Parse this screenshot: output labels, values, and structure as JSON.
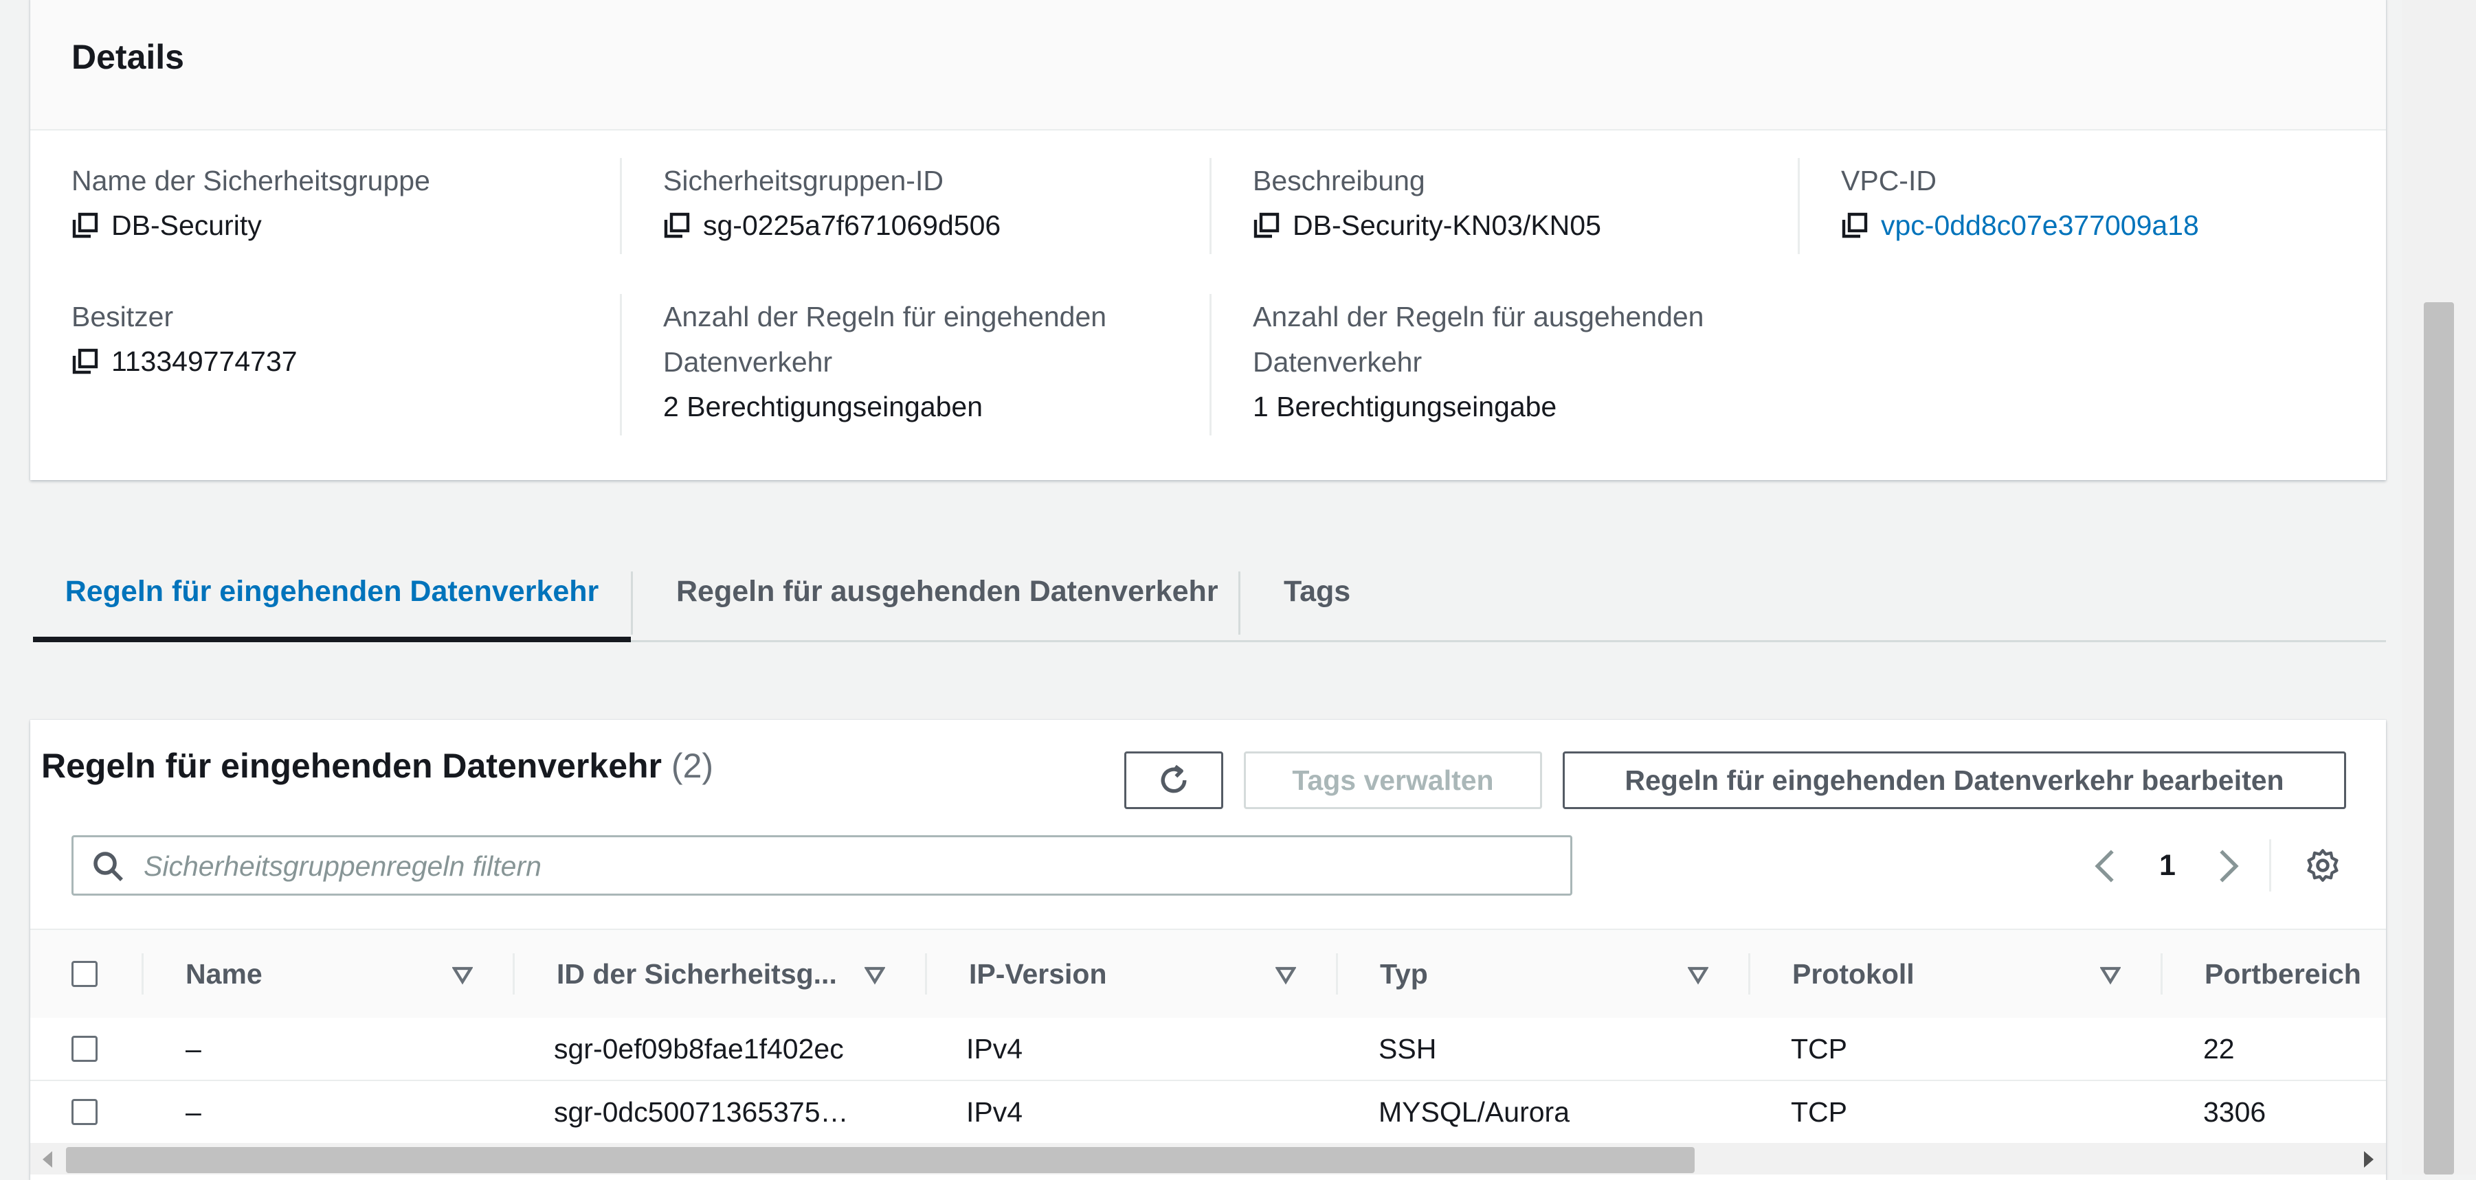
{
  "details": {
    "title": "Details",
    "fields": [
      {
        "label": "Name der Sicherheitsgruppe",
        "value": "DB-Security"
      },
      {
        "label": "Sicherheitsgruppen-ID",
        "value": "sg-0225a7f671069d506"
      },
      {
        "label": "Beschreibung",
        "value": "DB-Security-KN03/KN05"
      },
      {
        "label": "VPC-ID",
        "value": "vpc-0dd8c07e377009a18"
      },
      {
        "label": "Besitzer",
        "value": "113349774737"
      },
      {
        "label": "Anzahl der Regeln für eingehenden Datenverkehr",
        "value": "2 Berechtigungseingaben"
      },
      {
        "label": "Anzahl der Regeln für ausgehenden Datenverkehr",
        "value": "1 Berechtigungseingabe"
      }
    ]
  },
  "tabs": [
    {
      "label": "Regeln für eingehenden Datenverkehr",
      "active": true
    },
    {
      "label": "Regeln für ausgehenden Datenverkehr",
      "active": false
    },
    {
      "label": "Tags",
      "active": false
    }
  ],
  "rules": {
    "title": "Regeln für eingehenden Datenverkehr",
    "count": "(2)",
    "manage_tags_label": "Tags verwalten",
    "edit_label": "Regeln für eingehenden Datenverkehr bearbeiten",
    "search_placeholder": "Sicherheitsgruppenregeln filtern",
    "page": "1",
    "columns": [
      "Name",
      "ID der Sicherheitsg...",
      "IP-Version",
      "Typ",
      "Protokoll",
      "Portbereich"
    ],
    "rows": [
      [
        "–",
        "sgr-0ef09b8fae1f402ec",
        "IPv4",
        "SSH",
        "TCP",
        "22"
      ],
      [
        "–",
        "sgr-0dc50071365375…",
        "IPv4",
        "MYSQL/Aurora",
        "TCP",
        "3306"
      ]
    ]
  },
  "icons": {
    "copy": "copy-icon",
    "refresh": "refresh-icon",
    "search": "search-icon",
    "settings": "gear-icon",
    "sort": "sort-caret-icon"
  },
  "colors": {
    "link": "#0073bb",
    "text": "#16191f",
    "muted": "#545b64",
    "background": "#f2f3f3"
  }
}
